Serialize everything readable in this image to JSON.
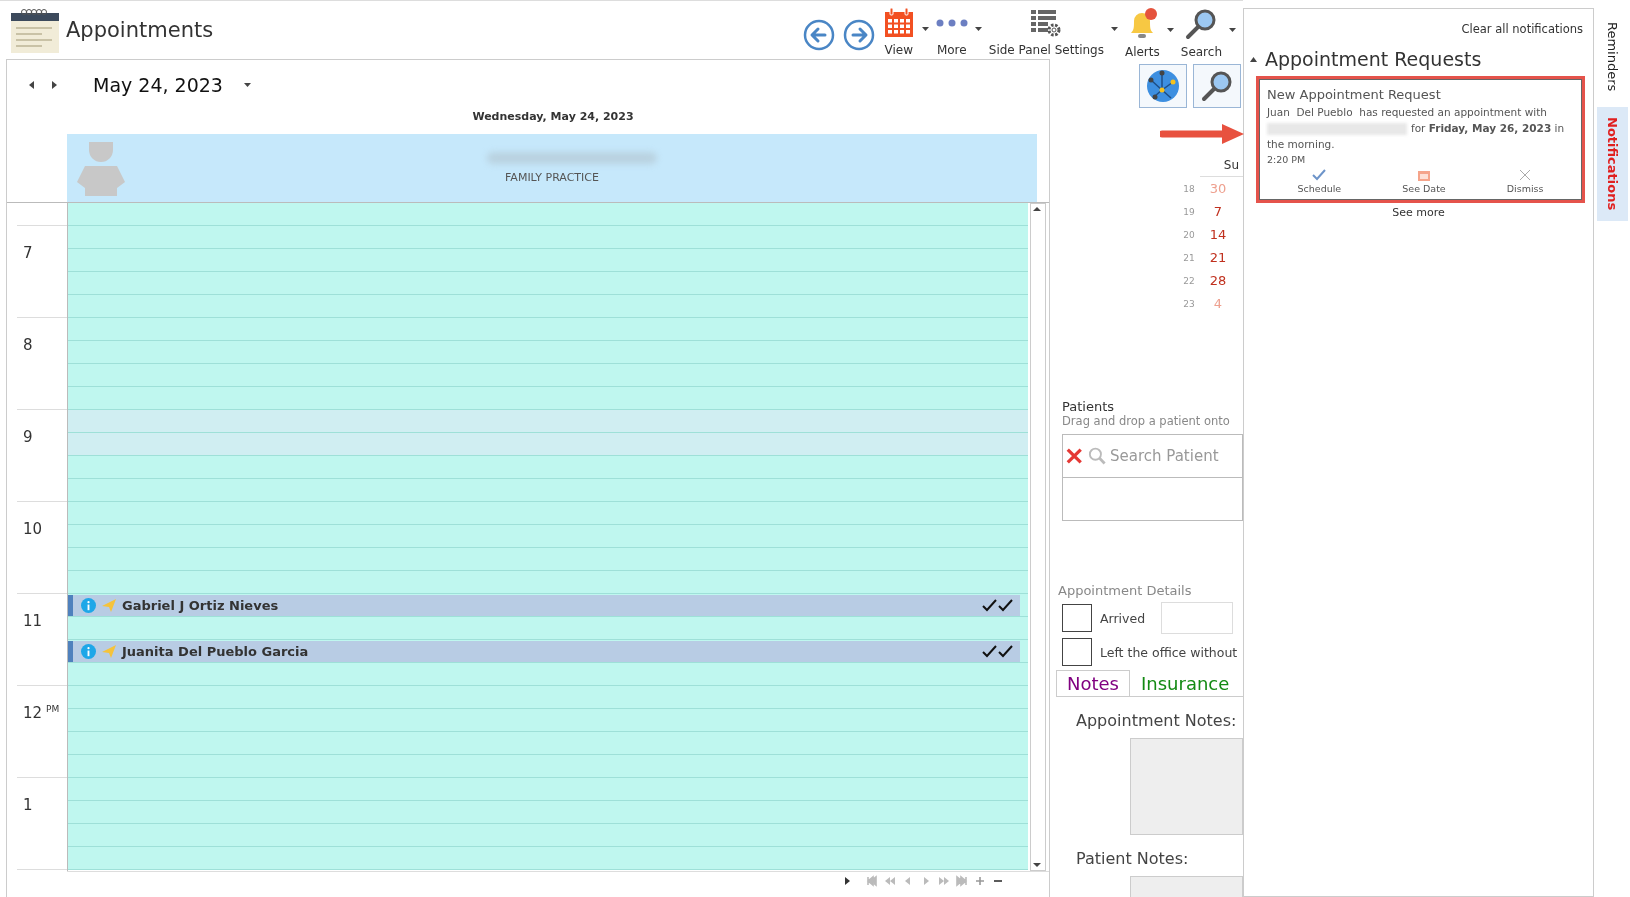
{
  "app": {
    "title": "Appointments"
  },
  "toolbar": [
    {
      "kind": "back"
    },
    {
      "kind": "forward"
    },
    {
      "kind": "view",
      "label": "View",
      "dropdown": true
    },
    {
      "kind": "more",
      "label": "More",
      "dropdown": true
    },
    {
      "kind": "side_panel_settings",
      "label": "Side Panel Settings",
      "dropdown": true
    },
    {
      "kind": "alerts",
      "label": "Alerts",
      "dropdown": true,
      "badge": true
    },
    {
      "kind": "search",
      "label": "Search",
      "dropdown": true
    }
  ],
  "calendar": {
    "date": "May 24, 2023",
    "day_header": "Wednesday, May 24, 2023",
    "resource": {
      "department": "FAMILY PRACTICE",
      "name_blurred": true
    },
    "leading_slots": [
      {
        "kind": "free"
      }
    ],
    "hours": [
      {
        "label": "7",
        "slots": [
          {
            "kind": "free"
          },
          {
            "kind": "free"
          },
          {
            "kind": "free"
          },
          {
            "kind": "free"
          }
        ]
      },
      {
        "label": "8",
        "slots": [
          {
            "kind": "free"
          },
          {
            "kind": "free"
          },
          {
            "kind": "free"
          },
          {
            "kind": "free"
          }
        ]
      },
      {
        "label": "9",
        "slots": [
          {
            "kind": "shaded"
          },
          {
            "kind": "shaded"
          },
          {
            "kind": "free"
          },
          {
            "kind": "free"
          }
        ]
      },
      {
        "label": "10",
        "slots": [
          {
            "kind": "free"
          },
          {
            "kind": "free"
          },
          {
            "kind": "free"
          },
          {
            "kind": "free"
          }
        ]
      },
      {
        "label": "11",
        "slots": [
          {
            "kind": "appointment",
            "patient": "Gabriel J Ortiz Nieves"
          },
          {
            "kind": "free"
          },
          {
            "kind": "appointment",
            "patient": "Juanita Del Pueblo Garcia"
          },
          {
            "kind": "free"
          }
        ]
      },
      {
        "label": "12",
        "suffix": "PM",
        "slots": [
          {
            "kind": "free"
          },
          {
            "kind": "free"
          },
          {
            "kind": "free"
          },
          {
            "kind": "free"
          }
        ]
      },
      {
        "label": "1",
        "slots": [
          {
            "kind": "free"
          },
          {
            "kind": "free"
          },
          {
            "kind": "free"
          },
          {
            "kind": "free"
          }
        ]
      }
    ]
  },
  "side_panel": {
    "quick_buttons": [
      {
        "kind": "globe"
      },
      {
        "kind": "search"
      }
    ],
    "mini_calendar": {
      "header": "Su",
      "weeks": [
        {
          "week": "18",
          "day": "30",
          "other_month": true
        },
        {
          "week": "19",
          "day": "7",
          "other_month": false
        },
        {
          "week": "20",
          "day": "14",
          "other_month": false
        },
        {
          "week": "21",
          "day": "21",
          "other_month": false
        },
        {
          "week": "22",
          "day": "28",
          "other_month": false
        },
        {
          "week": "23",
          "day": "4",
          "other_month": true
        }
      ]
    },
    "patients": {
      "title": "Patients",
      "hint": "Drag and drop a patient onto",
      "search_placeholder": "Search Patient"
    },
    "details": {
      "title": "Appointment Details",
      "checkboxes": [
        {
          "label": "Arrived",
          "checked": false
        },
        {
          "label": "Left the office without",
          "checked": false
        }
      ]
    },
    "tabs": [
      {
        "label": "Notes",
        "selected": true,
        "color": "#800080"
      },
      {
        "label": "Insurance",
        "selected": false,
        "color": "#138a13"
      }
    ],
    "appointment_notes_label": "Appointment Notes:",
    "patient_notes_label": "Patient Notes:"
  },
  "notifications": {
    "clear_all": "Clear all notifications",
    "section": {
      "title": "Appointment Requests",
      "expanded": true
    },
    "card": {
      "title": "New Appointment Request",
      "text": "Juan  Del Pueblo  has requested an appointment with",
      "text_after": "for **Friday, May 26, 2023** in the morning.",
      "time": "2:20 PM",
      "highlighted": true,
      "callout_arrow": true,
      "actions": [
        {
          "kind": "schedule",
          "label": "Schedule"
        },
        {
          "kind": "see_date",
          "label": "See Date"
        },
        {
          "kind": "dismiss",
          "label": "Dismiss"
        }
      ]
    },
    "see_more": "See more"
  },
  "side_tabs": [
    {
      "label": "Reminders",
      "selected": false
    },
    {
      "label": "Notifications",
      "selected": true
    }
  ]
}
